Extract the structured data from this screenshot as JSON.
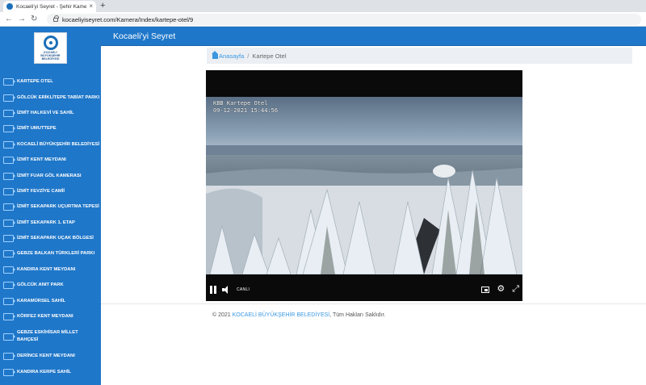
{
  "browser": {
    "tab_title": "Kocaeli'yi Seyret - Şehir Kameraları",
    "tab_close": "×",
    "new_tab": "+",
    "url": "kocaeliyiseyret.com/Kamera/Index/kartepe-otel/9",
    "back": "←",
    "forward": "→",
    "reload": "↻"
  },
  "logo": {
    "text": "KOCAELİ BÜYÜKŞEHİR BELEDİYESİ"
  },
  "header": {
    "title": "Kocaeli'yi Seyret"
  },
  "sidebar": {
    "items": [
      {
        "label": "KARTEPE OTEL"
      },
      {
        "label": "GÖLCÜK ERİKLİTEPE TABİAT PARKI"
      },
      {
        "label": "İZMİT HALKEVİ VE SAHİL"
      },
      {
        "label": "İZMİT UMUTTEPE"
      },
      {
        "label": "KOCAELİ BÜYÜKŞEHİR BELEDİYESİ"
      },
      {
        "label": "İZMİT KENT MEYDANI"
      },
      {
        "label": "İZMİT FUAR GÖL KAMERASI"
      },
      {
        "label": "İZMİT FEVZİYE CAMİİ"
      },
      {
        "label": "İZMİT SEKAPARK UÇURTMA TEPESİ"
      },
      {
        "label": "İZMİT SEKAPARK 1. ETAP"
      },
      {
        "label": "İZMİT SEKAPARK UÇAK BÖLGESİ"
      },
      {
        "label": "GEBZE BALKAN TÜRKLERİ PARKI"
      },
      {
        "label": "KANDIRA KENT MEYDANI"
      },
      {
        "label": "GÖLCÜK ANIT PARK"
      },
      {
        "label": "KARAMÜRSEL SAHİL"
      },
      {
        "label": "KÖRFEZ KENT MEYDANI"
      },
      {
        "label": "GEBZE ESKİHİSAR MİLLET BAHÇESİ"
      },
      {
        "label": "DERİNCE KENT MEYDANI"
      },
      {
        "label": "KANDIRA KERPE SAHİL"
      }
    ]
  },
  "breadcrumb": {
    "home": "Anasayfa",
    "separator": "/",
    "current": "Kartepe Otel"
  },
  "player": {
    "overlay_line1": "KBB Kartepe Otel",
    "overlay_line2": "09-12-2021 15:44:56",
    "live_label": "CANLI"
  },
  "footer": {
    "prefix": "© 2021",
    "link": "KOCAELİ BÜYÜKŞEHİR BELEDİYESİ",
    "suffix": ", Tüm Hakları Saklıdır."
  },
  "colors": {
    "brand_blue": "#1f77c9",
    "link_blue": "#3a97e0"
  }
}
